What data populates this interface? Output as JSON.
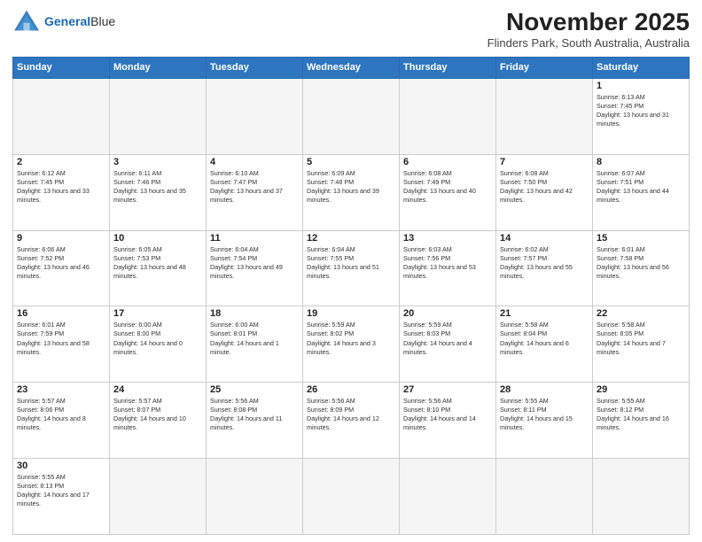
{
  "header": {
    "logo_line1": "General",
    "logo_line2": "Blue",
    "month": "November 2025",
    "location": "Flinders Park, South Australia, Australia"
  },
  "weekdays": [
    "Sunday",
    "Monday",
    "Tuesday",
    "Wednesday",
    "Thursday",
    "Friday",
    "Saturday"
  ],
  "days": {
    "1": {
      "sunrise": "6:13 AM",
      "sunset": "7:45 PM",
      "daylight": "13 hours and 31 minutes."
    },
    "2": {
      "sunrise": "6:12 AM",
      "sunset": "7:45 PM",
      "daylight": "13 hours and 33 minutes."
    },
    "3": {
      "sunrise": "6:11 AM",
      "sunset": "7:46 PM",
      "daylight": "13 hours and 35 minutes."
    },
    "4": {
      "sunrise": "6:10 AM",
      "sunset": "7:47 PM",
      "daylight": "13 hours and 37 minutes."
    },
    "5": {
      "sunrise": "6:09 AM",
      "sunset": "7:48 PM",
      "daylight": "13 hours and 39 minutes."
    },
    "6": {
      "sunrise": "6:08 AM",
      "sunset": "7:49 PM",
      "daylight": "13 hours and 40 minutes."
    },
    "7": {
      "sunrise": "6:08 AM",
      "sunset": "7:50 PM",
      "daylight": "13 hours and 42 minutes."
    },
    "8": {
      "sunrise": "6:07 AM",
      "sunset": "7:51 PM",
      "daylight": "13 hours and 44 minutes."
    },
    "9": {
      "sunrise": "6:06 AM",
      "sunset": "7:52 PM",
      "daylight": "13 hours and 46 minutes."
    },
    "10": {
      "sunrise": "6:05 AM",
      "sunset": "7:53 PM",
      "daylight": "13 hours and 48 minutes."
    },
    "11": {
      "sunrise": "6:04 AM",
      "sunset": "7:54 PM",
      "daylight": "13 hours and 49 minutes."
    },
    "12": {
      "sunrise": "6:04 AM",
      "sunset": "7:55 PM",
      "daylight": "13 hours and 51 minutes."
    },
    "13": {
      "sunrise": "6:03 AM",
      "sunset": "7:56 PM",
      "daylight": "13 hours and 53 minutes."
    },
    "14": {
      "sunrise": "6:02 AM",
      "sunset": "7:57 PM",
      "daylight": "13 hours and 55 minutes."
    },
    "15": {
      "sunrise": "6:01 AM",
      "sunset": "7:58 PM",
      "daylight": "13 hours and 56 minutes."
    },
    "16": {
      "sunrise": "6:01 AM",
      "sunset": "7:59 PM",
      "daylight": "13 hours and 58 minutes."
    },
    "17": {
      "sunrise": "6:00 AM",
      "sunset": "8:00 PM",
      "daylight": "14 hours and 0 minutes."
    },
    "18": {
      "sunrise": "6:00 AM",
      "sunset": "8:01 PM",
      "daylight": "14 hours and 1 minute."
    },
    "19": {
      "sunrise": "5:59 AM",
      "sunset": "8:02 PM",
      "daylight": "14 hours and 3 minutes."
    },
    "20": {
      "sunrise": "5:59 AM",
      "sunset": "8:03 PM",
      "daylight": "14 hours and 4 minutes."
    },
    "21": {
      "sunrise": "5:58 AM",
      "sunset": "8:04 PM",
      "daylight": "14 hours and 6 minutes."
    },
    "22": {
      "sunrise": "5:58 AM",
      "sunset": "8:05 PM",
      "daylight": "14 hours and 7 minutes."
    },
    "23": {
      "sunrise": "5:57 AM",
      "sunset": "8:06 PM",
      "daylight": "14 hours and 8 minutes."
    },
    "24": {
      "sunrise": "5:57 AM",
      "sunset": "8:07 PM",
      "daylight": "14 hours and 10 minutes."
    },
    "25": {
      "sunrise": "5:56 AM",
      "sunset": "8:08 PM",
      "daylight": "14 hours and 11 minutes."
    },
    "26": {
      "sunrise": "5:56 AM",
      "sunset": "8:09 PM",
      "daylight": "14 hours and 12 minutes."
    },
    "27": {
      "sunrise": "5:56 AM",
      "sunset": "8:10 PM",
      "daylight": "14 hours and 14 minutes."
    },
    "28": {
      "sunrise": "5:55 AM",
      "sunset": "8:11 PM",
      "daylight": "14 hours and 15 minutes."
    },
    "29": {
      "sunrise": "5:55 AM",
      "sunset": "8:12 PM",
      "daylight": "14 hours and 16 minutes."
    },
    "30": {
      "sunrise": "5:55 AM",
      "sunset": "8:13 PM",
      "daylight": "14 hours and 17 minutes."
    }
  }
}
